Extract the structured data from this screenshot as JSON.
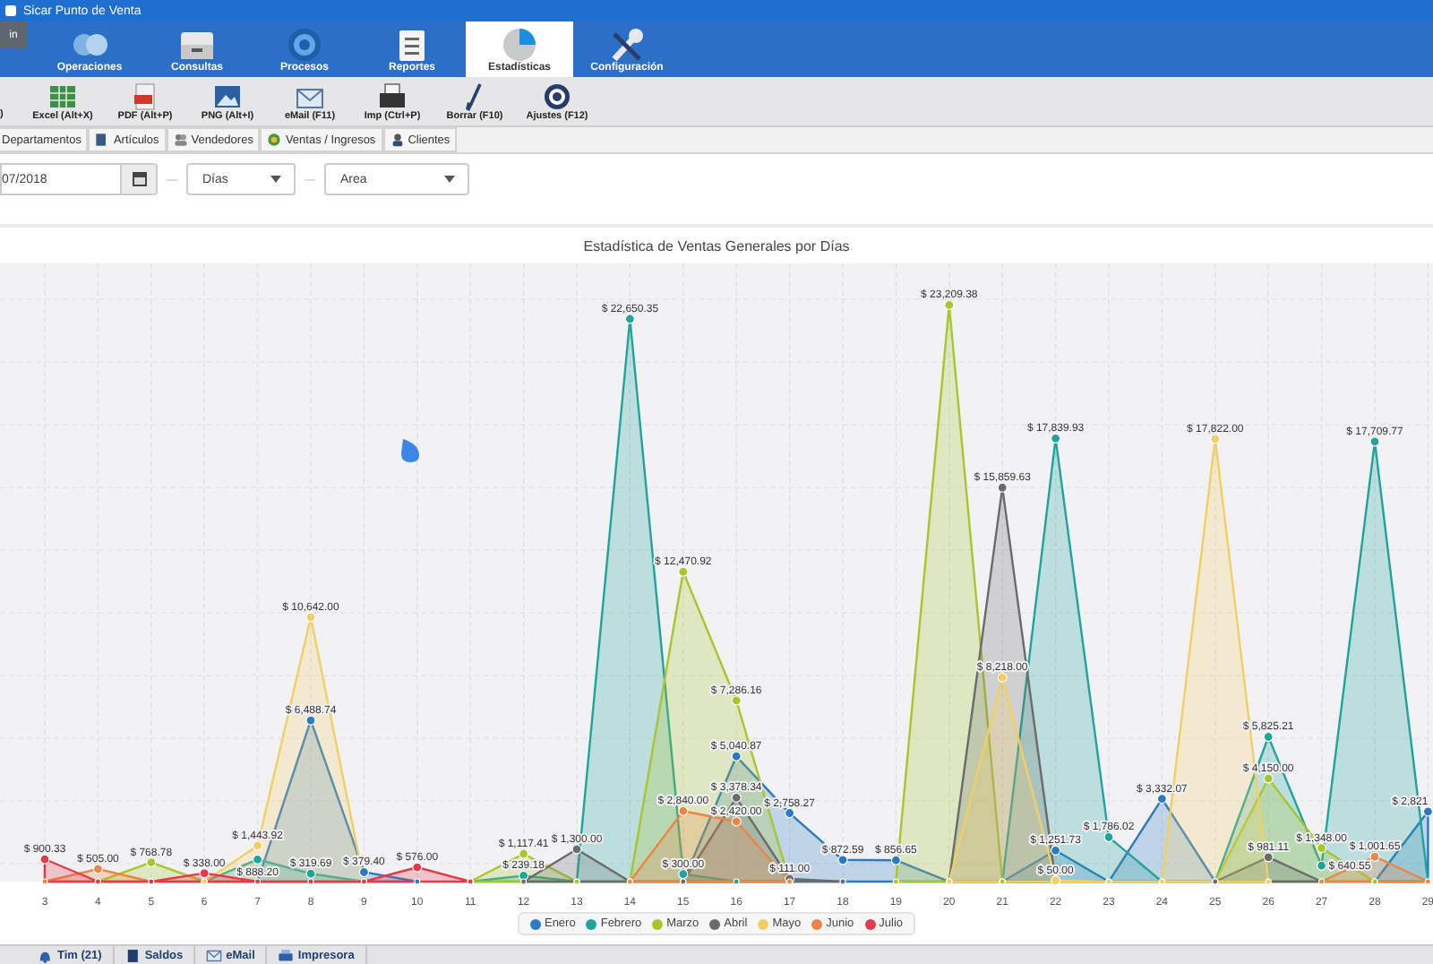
{
  "window": {
    "title": "Sicar Punto de Venta"
  },
  "user_button": {
    "label": "in"
  },
  "ribbon_tabs": [
    {
      "label": "Operaciones",
      "selected": false
    },
    {
      "label": "Consultas",
      "selected": false
    },
    {
      "label": "Procesos",
      "selected": false
    },
    {
      "label": "Reportes",
      "selected": false
    },
    {
      "label": "Estadísticas",
      "selected": true
    },
    {
      "label": "Configuración",
      "selected": false
    }
  ],
  "toolbar": [
    {
      "label": ")"
    },
    {
      "label": "Excel (Alt+X)"
    },
    {
      "label": "PDF (Alt+P)"
    },
    {
      "label": "PNG (Alt+I)"
    },
    {
      "label": "eMail (F11)"
    },
    {
      "label": "Imp (Ctrl+P)"
    },
    {
      "label": "Borrar (F10)"
    },
    {
      "label": "Ajustes (F12)"
    }
  ],
  "sub_tabs": [
    {
      "label": "Departamentos"
    },
    {
      "label": "Artículos"
    },
    {
      "label": "Vendedores"
    },
    {
      "label": "Ventas / Ingresos"
    },
    {
      "label": "Clientes"
    }
  ],
  "filters": {
    "date": "07/2018",
    "period": "Días",
    "chart_type": "Area"
  },
  "chart": {
    "chart_data": {
      "type": "area",
      "title": "Estadística de Ventas Generales por Días",
      "grid": true,
      "categories": [
        "3",
        "4",
        "5",
        "6",
        "7",
        "8",
        "9",
        "10",
        "11",
        "12",
        "13",
        "14",
        "15",
        "16",
        "17",
        "18",
        "19",
        "20",
        "21",
        "22",
        "23",
        "24",
        "25",
        "26",
        "27",
        "28",
        "29"
      ],
      "series": [
        {
          "name": "Enero",
          "color": "#2a7abf",
          "values": [
            null,
            null,
            null,
            null,
            0,
            6488.74,
            379.4,
            0,
            null,
            null,
            null,
            null,
            0,
            5040.87,
            2758.27,
            872.59,
            856.65,
            0,
            0,
            1251.73,
            0,
            3332.07,
            0,
            null,
            null,
            0,
            2821
          ],
          "value_labels": [
            null,
            null,
            null,
            null,
            null,
            "$ 6,488.74",
            "$ 379.40",
            null,
            null,
            null,
            null,
            null,
            null,
            "$ 5,040.87",
            "$ 2,758.27",
            "$ 872.59",
            "$ 856.65",
            null,
            null,
            "$ 1,251.73",
            null,
            "$ 3,332.07",
            null,
            null,
            null,
            null,
            "$ 2,821"
          ]
        },
        {
          "name": "Febrero",
          "color": "#1fa39a",
          "values": [
            null,
            null,
            null,
            0,
            888.2,
            319.69,
            0,
            null,
            0,
            239.18,
            0,
            22650.35,
            300.0,
            0,
            null,
            null,
            null,
            null,
            0,
            17839.93,
            1786.02,
            0,
            0,
            5825.21,
            640.55,
            17709.77,
            0
          ],
          "value_labels": [
            null,
            null,
            null,
            null,
            "$ 888.20",
            "$ 319.69",
            null,
            null,
            null,
            "$ 239.18",
            null,
            "$ 22,650.35",
            "$ 300.00",
            null,
            null,
            null,
            null,
            null,
            null,
            "$ 17,839.93",
            "$ 1,786.02",
            null,
            null,
            "$ 5,825.21",
            "$ 640.55",
            "$ 17,709.77",
            null
          ]
        },
        {
          "name": "Marzo",
          "color": "#a8c62c",
          "values": [
            null,
            0,
            768.78,
            0,
            null,
            null,
            null,
            null,
            0,
            1117.41,
            0,
            0,
            12470.92,
            7286.16,
            0,
            null,
            0,
            23209.38,
            0,
            null,
            null,
            null,
            0,
            4150.0,
            1348.0,
            0,
            null
          ],
          "value_labels": [
            null,
            null,
            "$ 768.78",
            null,
            null,
            null,
            null,
            null,
            null,
            "$ 1,117.41",
            null,
            null,
            "$ 12,470.92",
            "$ 7,286.16",
            null,
            null,
            null,
            "$ 23,209.38",
            null,
            null,
            null,
            null,
            null,
            "$ 4,150.00",
            "$ 1,348.00",
            null,
            null
          ]
        },
        {
          "name": "Abril",
          "color": "#6b6b6b",
          "values": [
            null,
            null,
            null,
            null,
            null,
            null,
            null,
            null,
            null,
            0,
            1300.0,
            0,
            0,
            3378.34,
            111.0,
            0,
            null,
            0,
            15859.63,
            0,
            null,
            null,
            0,
            981.11,
            0,
            null,
            null
          ],
          "value_labels": [
            null,
            null,
            null,
            null,
            null,
            null,
            null,
            null,
            null,
            null,
            "$ 1,300.00",
            null,
            null,
            "$ 3,378.34",
            "$ 111.00",
            null,
            null,
            null,
            "$ 15,859.63",
            null,
            null,
            null,
            null,
            "$ 981.11",
            null,
            null,
            null
          ]
        },
        {
          "name": "Mayo",
          "color": "#f2cf63",
          "values": [
            null,
            null,
            null,
            0,
            1443.92,
            10642.0,
            0,
            null,
            null,
            null,
            null,
            null,
            null,
            null,
            null,
            null,
            null,
            0,
            8218.0,
            50.0,
            0,
            0,
            17822.0,
            0,
            null,
            null,
            null
          ],
          "value_labels": [
            null,
            null,
            null,
            null,
            "$ 1,443.92",
            "$ 10,642.00",
            null,
            null,
            null,
            null,
            null,
            null,
            null,
            null,
            null,
            null,
            null,
            null,
            "$ 8,218.00",
            "$ 50.00",
            null,
            null,
            "$ 17,822.00",
            null,
            null,
            null,
            null
          ]
        },
        {
          "name": "Junio",
          "color": "#ee8445",
          "values": [
            0,
            505.0,
            0,
            null,
            null,
            null,
            null,
            null,
            null,
            null,
            null,
            0,
            2840.0,
            2420.0,
            0,
            null,
            null,
            null,
            null,
            null,
            null,
            null,
            null,
            null,
            0,
            1001.65,
            0
          ],
          "value_labels": [
            null,
            "$ 505.00",
            null,
            null,
            null,
            null,
            null,
            null,
            null,
            null,
            null,
            null,
            "$ 2,840.00",
            "$ 2,420.00",
            null,
            null,
            null,
            null,
            null,
            null,
            null,
            null,
            null,
            null,
            null,
            "$ 1,001.65",
            null
          ]
        },
        {
          "name": "Julio",
          "color": "#e8394a",
          "values": [
            900.33,
            0,
            0,
            338.0,
            0,
            0,
            0,
            576.0,
            0,
            null,
            null,
            null,
            null,
            null,
            null,
            null,
            null,
            null,
            null,
            null,
            null,
            null,
            null,
            null,
            null,
            null,
            null
          ],
          "value_labels": [
            "$ 900.33",
            null,
            null,
            "$ 338.00",
            null,
            null,
            null,
            "$ 576.00",
            null,
            null,
            null,
            null,
            null,
            null,
            null,
            null,
            null,
            null,
            null,
            null,
            null,
            null,
            null,
            null,
            null,
            null,
            null
          ]
        }
      ]
    }
  },
  "status_bar": [
    {
      "label": "Tim (21)"
    },
    {
      "label": "Saldos"
    },
    {
      "label": "eMail"
    },
    {
      "label": "Impresora"
    }
  ]
}
